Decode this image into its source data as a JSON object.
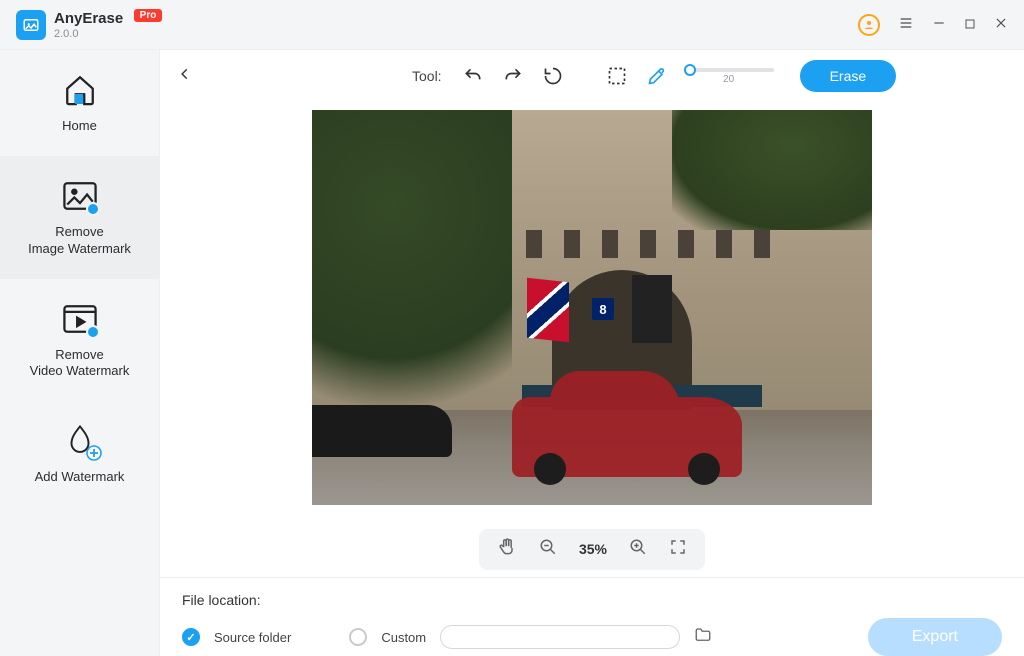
{
  "app": {
    "name": "AnyErase",
    "version": "2.0.0",
    "badge": "Pro"
  },
  "sidebar": {
    "items": [
      {
        "label": "Home"
      },
      {
        "label": "Remove\nImage Watermark"
      },
      {
        "label": "Remove\nVideo Watermark"
      },
      {
        "label": "Add Watermark"
      }
    ],
    "active_index": 1
  },
  "toolbar": {
    "label": "Tool:",
    "brush_size": "20",
    "erase_label": "Erase"
  },
  "canvas": {
    "building_number": "8"
  },
  "zoom": {
    "value": "35%"
  },
  "footer": {
    "location_label": "File location:",
    "source_label": "Source folder",
    "custom_label": "Custom",
    "export_label": "Export"
  }
}
